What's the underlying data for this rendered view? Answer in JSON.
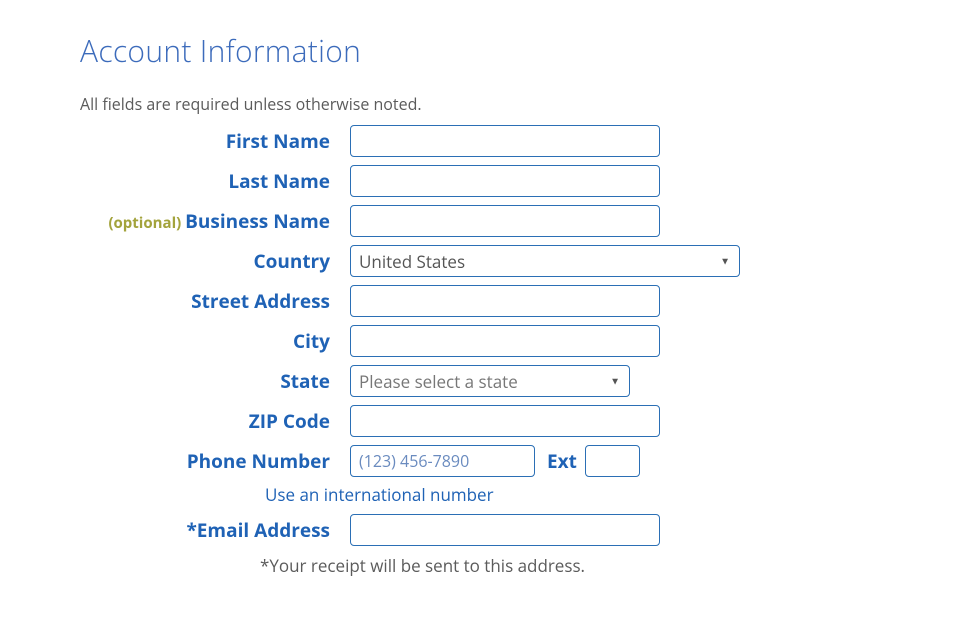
{
  "heading": "Account Information",
  "subhead": "All fields are required unless otherwise noted.",
  "labels": {
    "first_name": "First Name",
    "last_name": "Last Name",
    "business_name": "Business Name",
    "optional": "(optional) ",
    "country": "Country",
    "street_address": "Street Address",
    "city": "City",
    "state": "State",
    "zip": "ZIP Code",
    "phone": "Phone Number",
    "ext": "Ext",
    "email": "*Email Address"
  },
  "values": {
    "country_selected": "United States",
    "state_placeholder": "Please select a state",
    "phone_placeholder": "(123) 456-7890"
  },
  "intl_link": "Use an international number",
  "receipt_note": "*Your receipt will be sent to this address."
}
